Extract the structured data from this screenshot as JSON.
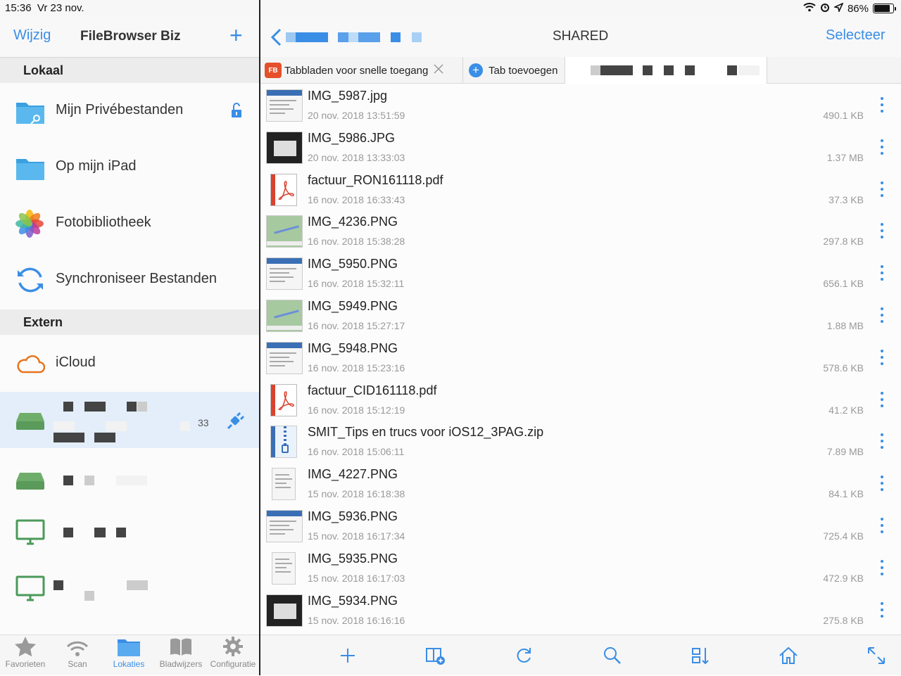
{
  "status": {
    "time": "15:36",
    "date": "Vr 23 nov.",
    "battery": "86%"
  },
  "left_nav": {
    "edit_label": "Wijzig",
    "title": "FileBrowser Biz",
    "add_label": "+"
  },
  "sections": {
    "local": "Lokaal",
    "external": "Extern"
  },
  "local_items": [
    {
      "label": "Mijn Privébestanden"
    },
    {
      "label": "Op mijn iPad"
    },
    {
      "label": "Fotobibliotheek"
    },
    {
      "label": "Synchroniseer Bestanden"
    }
  ],
  "external_items": [
    {
      "label": "iCloud"
    }
  ],
  "selected_item_fragment": "33",
  "right_nav": {
    "title": "SHARED",
    "select_label": "Selecteer"
  },
  "tabs": {
    "quick_access": "Tabbladen voor snelle toegang",
    "fb_badge": "FB",
    "add_tab": "Tab toevoegen"
  },
  "files": [
    {
      "name": "IMG_5987.jpg",
      "date": "20 nov. 2018 13:51:59",
      "size": "490.1 KB",
      "thumb": "screen"
    },
    {
      "name": "IMG_5986.JPG",
      "date": "20 nov. 2018 13:33:03",
      "size": "1.37 MB",
      "thumb": "dark"
    },
    {
      "name": "factuur_RON161118.pdf",
      "date": "16 nov. 2018 16:33:43",
      "size": "37.3 KB",
      "thumb": "pdf"
    },
    {
      "name": "IMG_4236.PNG",
      "date": "16 nov. 2018 15:38:28",
      "size": "297.8 KB",
      "thumb": "map"
    },
    {
      "name": "IMG_5950.PNG",
      "date": "16 nov. 2018 15:32:11",
      "size": "656.1 KB",
      "thumb": "screen"
    },
    {
      "name": "IMG_5949.PNG",
      "date": "16 nov. 2018 15:27:17",
      "size": "1.88 MB",
      "thumb": "map"
    },
    {
      "name": "IMG_5948.PNG",
      "date": "16 nov. 2018 15:23:16",
      "size": "578.6 KB",
      "thumb": "screen"
    },
    {
      "name": "factuur_CID161118.pdf",
      "date": "16 nov. 2018 15:12:19",
      "size": "41.2 KB",
      "thumb": "pdf"
    },
    {
      "name": "SMIT_Tips en trucs voor iOS12_3PAG.zip",
      "date": "16 nov. 2018 15:06:11",
      "size": "7.89 MB",
      "thumb": "zip"
    },
    {
      "name": "IMG_4227.PNG",
      "date": "15 nov. 2018 16:18:38",
      "size": "84.1 KB",
      "thumb": "doc"
    },
    {
      "name": "IMG_5936.PNG",
      "date": "15 nov. 2018 16:17:34",
      "size": "725.4 KB",
      "thumb": "screen"
    },
    {
      "name": "IMG_5935.PNG",
      "date": "15 nov. 2018 16:17:03",
      "size": "472.9 KB",
      "thumb": "doc"
    },
    {
      "name": "IMG_5934.PNG",
      "date": "15 nov. 2018 16:16:16",
      "size": "275.8 KB",
      "thumb": "dark"
    }
  ],
  "bottom_tabs": [
    {
      "label": "Favorieten",
      "icon": "star-icon"
    },
    {
      "label": "Scan",
      "icon": "wifi-icon"
    },
    {
      "label": "Lokaties",
      "icon": "folder-icon",
      "active": true
    },
    {
      "label": "Bladwijzers",
      "icon": "book-icon"
    },
    {
      "label": "Configuratie",
      "icon": "gear-icon"
    }
  ],
  "colors": {
    "accent": "#3a8ee6",
    "selected_bg": "#e3eefa",
    "fb_red": "#e5502b",
    "drive_green": "#5a9a5a"
  }
}
